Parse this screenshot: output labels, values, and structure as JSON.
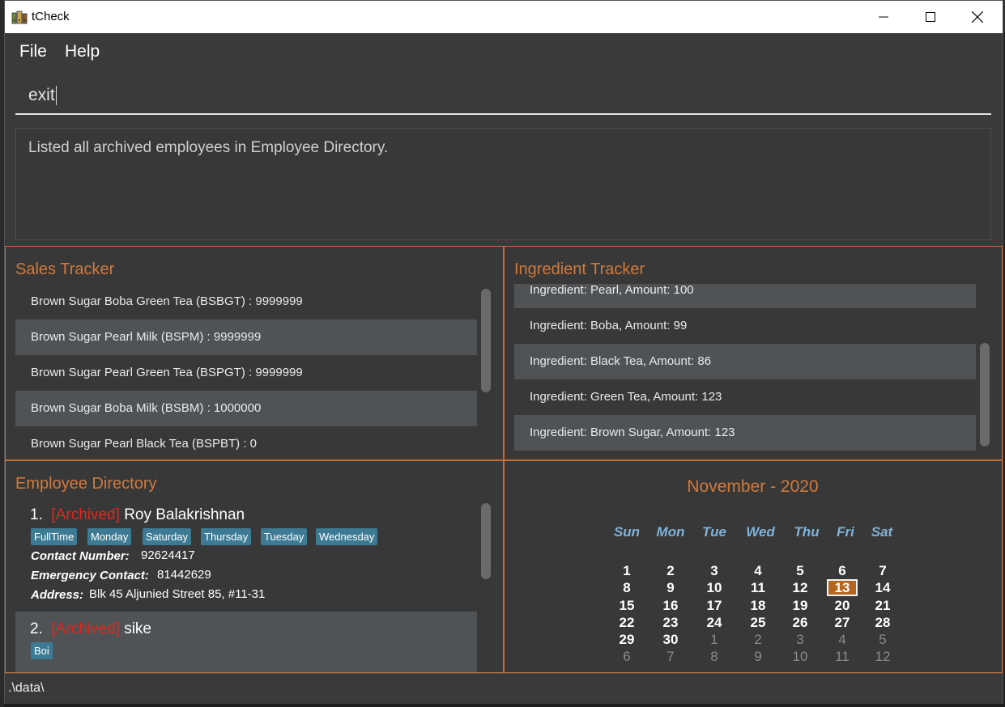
{
  "window": {
    "title": "tCheck"
  },
  "menu": {
    "file": "File",
    "help": "Help"
  },
  "command": {
    "value": "exit"
  },
  "result": {
    "message": "Listed all archived employees in Employee Directory."
  },
  "sales": {
    "title": "Sales Tracker",
    "items": [
      "Brown Sugar Boba Green Tea (BSBGT) : 9999999",
      "Brown Sugar Pearl Milk (BSPM) : 9999999",
      "Brown Sugar Pearl Green Tea (BSPGT) : 9999999",
      "Brown Sugar Boba Milk (BSBM) : 1000000",
      "Brown Sugar Pearl Black Tea (BSPBT) : 0"
    ]
  },
  "ingredients": {
    "title": "Ingredient Tracker",
    "items": [
      "Ingredient: Pearl,  Amount: 100",
      "Ingredient: Boba,  Amount: 99",
      "Ingredient: Black Tea,  Amount: 86",
      "Ingredient: Green Tea,  Amount: 123",
      "Ingredient: Brown Sugar,  Amount: 123"
    ]
  },
  "employees": {
    "title": "Employee Directory",
    "list": [
      {
        "index": "1.",
        "status": "[Archived]",
        "name": "Roy Balakrishnan",
        "tags": [
          "FullTime",
          "Monday",
          "Saturday",
          "Thursday",
          "Tuesday",
          "Wednesday"
        ],
        "contact_label": "Contact Number:",
        "contact": "92624417",
        "emergency_label": "Emergency Contact:",
        "emergency": "81442629",
        "address_label": "Address:",
        "address": "Blk 45 Aljunied Street 85, #11-31"
      },
      {
        "index": "2.",
        "status": "[Archived]",
        "name": "sike",
        "tags": [
          "Boi"
        ]
      }
    ]
  },
  "calendar": {
    "title": "November - 2020",
    "weekdays": [
      "Sun",
      "Mon",
      "Tue",
      "Wed",
      "Thu",
      "Fri",
      "Sat"
    ],
    "today": "13",
    "weeks": [
      [
        "1",
        "2",
        "3",
        "4",
        "5",
        "6",
        "7"
      ],
      [
        "8",
        "9",
        "10",
        "11",
        "12",
        "13",
        "14"
      ],
      [
        "15",
        "16",
        "17",
        "18",
        "19",
        "20",
        "21"
      ],
      [
        "22",
        "23",
        "24",
        "25",
        "26",
        "27",
        "28"
      ],
      [
        "29",
        "30",
        "1",
        "2",
        "3",
        "4",
        "5"
      ],
      [
        "6",
        "7",
        "8",
        "9",
        "10",
        "11",
        "12"
      ]
    ],
    "colors": {
      "accent": "#d07a3c",
      "weekday": "#7fb2d9",
      "today_bg": "#b4661f"
    }
  },
  "status": {
    "path": ".\\data\\"
  },
  "colors": {
    "panel_border": "#c56d32",
    "tag_bg": "#3d7a94",
    "archived": "#e0261d",
    "background": "#3a3a3a"
  }
}
